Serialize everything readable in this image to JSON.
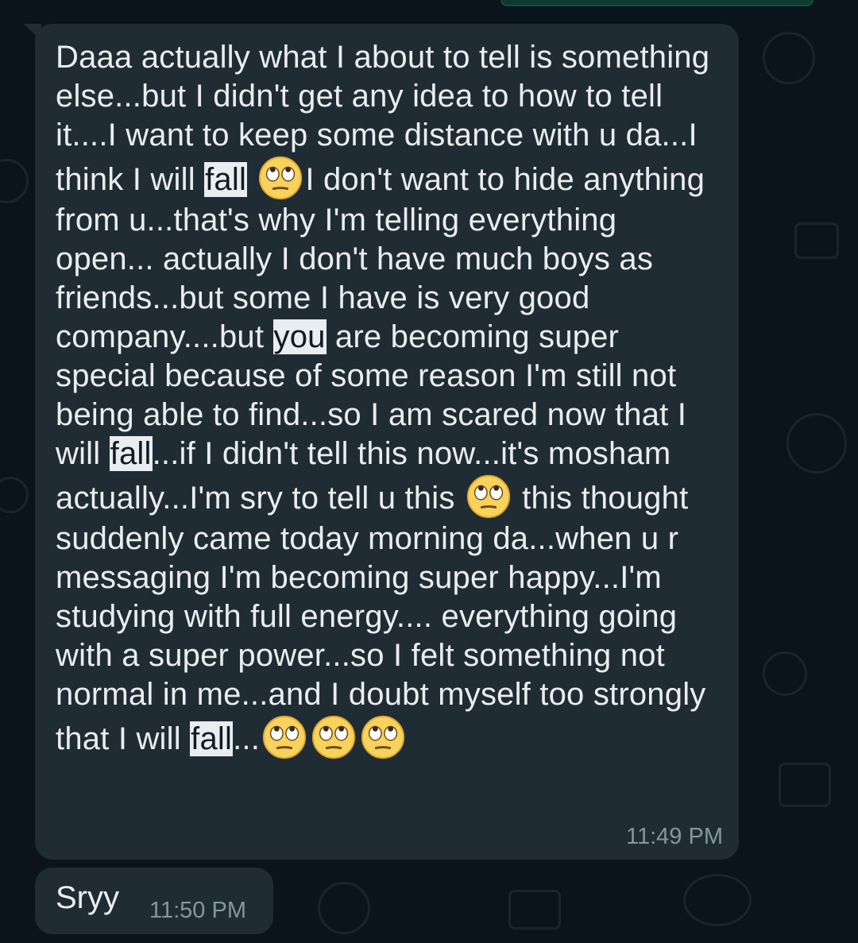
{
  "chat": {
    "messages": [
      {
        "segments": [
          "Daaa actually what I about to tell is something else...but I didn't get any idea to how to tell it....I want to keep some distance with u da...I think I will ",
          "fall",
          " ",
          "emoji-eyeroll",
          "I don't want to hide anything from u...that's why I'm telling everything open... actually I don't have much boys as friends...but some I have is very good company....but ",
          "you",
          " are becoming super special because of some reason I'm still not being able to find...so I am scared now that I will ",
          "fall",
          "...if I didn't tell this now...it's mosham actually...I'm sry to tell u this ",
          "emoji-eyeroll",
          " this thought suddenly came today morning da...when u r messaging I'm becoming super happy...I'm studying with full energy.... everything going with a super power...so I felt something not normal in me...and I doubt myself too strongly that I will ",
          "fall",
          "...",
          "emoji-eyeroll",
          "emoji-eyeroll",
          "emoji-eyeroll"
        ],
        "time": "11:49 PM"
      },
      {
        "text": "Sryy",
        "time": "11:50 PM"
      }
    ]
  },
  "theme": {
    "background": "#0b141a",
    "bubble": "#202c33",
    "text": "#e9edef",
    "meta": "#8696a0",
    "highlight": "#e9edef"
  }
}
